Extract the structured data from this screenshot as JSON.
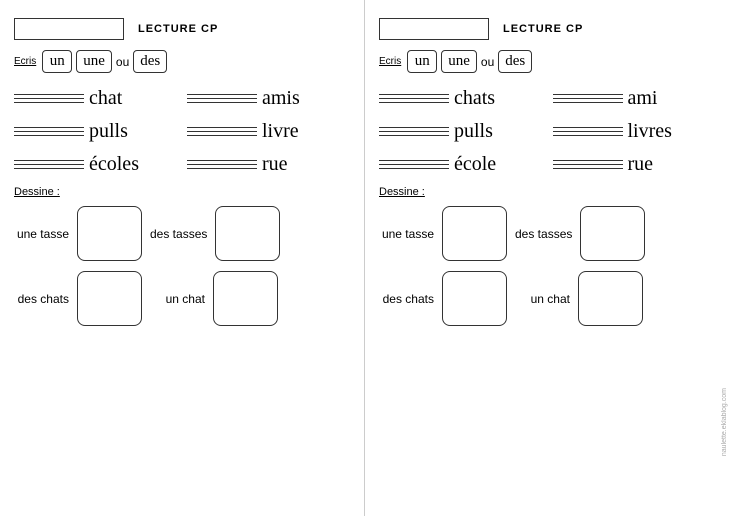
{
  "left": {
    "title": "LECTURE CP",
    "ecris": "Ecris",
    "words_ecris": [
      "un",
      "une",
      "ou",
      "des"
    ],
    "word_rows": [
      [
        "chat",
        "amis"
      ],
      [
        "pulls",
        "livre"
      ],
      [
        "écoles",
        "rue"
      ]
    ],
    "dessine_label": "Dessine :",
    "draw_rows": [
      {
        "left_label": "une tasse",
        "right_label": "des tasses"
      },
      {
        "left_label": "des chats",
        "right_label": "un chat"
      }
    ]
  },
  "right": {
    "title": "LECTURE CP",
    "ecris": "Ecris",
    "words_ecris": [
      "un",
      "une",
      "ou",
      "des"
    ],
    "word_rows": [
      [
        "chats",
        "ami"
      ],
      [
        "pulls",
        "livres"
      ],
      [
        "école",
        "rue"
      ]
    ],
    "dessine_label": "Dessine :",
    "draw_rows": [
      {
        "left_label": "une tasse",
        "right_label": "des tasses"
      },
      {
        "left_label": "des chats",
        "right_label": "un chat"
      }
    ]
  },
  "watermark": "naulette.eklablog.com"
}
